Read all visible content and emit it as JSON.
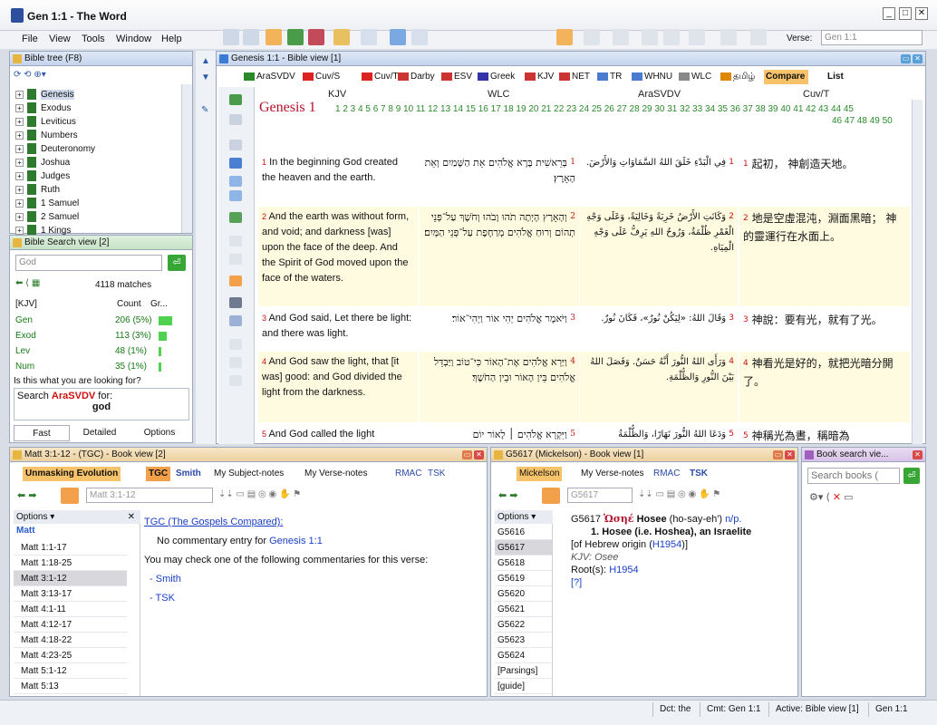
{
  "window": {
    "title": "Gen 1:1 - The Word"
  },
  "menu": [
    "File",
    "View",
    "Tools",
    "Window",
    "Help"
  ],
  "verse_label": "Verse:",
  "verse_value": "Gen 1:1",
  "bible_tree": {
    "title": "Bible tree (F8)",
    "books": [
      "Genesis",
      "Exodus",
      "Leviticus",
      "Numbers",
      "Deuteronomy",
      "Joshua",
      "Judges",
      "Ruth",
      "1 Samuel",
      "2 Samuel",
      "1 Kings"
    ]
  },
  "search_view": {
    "title": "Bible Search view [2]",
    "query": "God",
    "matches": "4118 matches",
    "col_version": "[KJV]",
    "col_count": "Count",
    "col_graph": "Gr...",
    "rows": [
      {
        "book": "Gen",
        "count": "206 (5%)",
        "pct": 5
      },
      {
        "book": "Exod",
        "count": "113 (3%)",
        "pct": 3
      },
      {
        "book": "Lev",
        "count": "48 (1%)",
        "pct": 1
      },
      {
        "book": "Num",
        "count": "35 (1%)",
        "pct": 1
      }
    ],
    "question": "Is this what you are looking for?",
    "search_prefix": "Search",
    "search_version": "AraSVDV",
    "search_suffix": "for:",
    "search_term": "god",
    "tabs": [
      "Fast",
      "Detailed",
      "Options"
    ]
  },
  "bible_view": {
    "title": "Genesis 1:1 - Bible view [1]",
    "tabs": [
      "AraSVDV",
      "Cuv/S",
      "Cuv/T",
      "Darby",
      "ESV",
      "Greek",
      "KJV",
      "NET",
      "TR",
      "WHNU",
      "WLC",
      "தமிழ்",
      "Compare",
      "List"
    ],
    "columns": [
      "KJV",
      "WLC",
      "AraSVDV",
      "Cuv/T"
    ],
    "heading": "Genesis 1",
    "chapters_line1": "1 2 3 4 5 6 7 8 9 10 11 12 13 14 15 16 17 18 19 20 21 22 23 24 25 26 27 28 29 30 31 32 33 34 35 36 37 38 39 40 41 42 43 44 45",
    "chapters_line2": "46 47 48 49 50",
    "verses": [
      {
        "n": "1",
        "kjv": "In the beginning God created the heaven and the earth.",
        "wlc": "בְּרֵאשִׁית בָּרָא אֱלֹהִים אֵת הַשָּׁמַיִם וְאֵת הָאָרֶץ׃",
        "ara": "فِي الْبَدْءِ خَلَقَ اللهُ السَّمَاوَاتِ وَالأَرْضَ.",
        "cuv": "起初， 神創造天地。"
      },
      {
        "n": "2",
        "kjv": "And the earth was without form, and void; and darkness [was] upon the face of the deep. And the Spirit of God moved upon the face of the waters.",
        "wlc": "וְהָאָרֶץ הָיְתָה תֹהוּ וָבֹהוּ וְחֹשֶׁךְ עַל־פְּנֵי תְהוֹם וְרוּחַ אֱלֹהִים מְרַחֶפֶת עַל־פְּנֵי הַמָּיִם׃",
        "ara": "وَكَانَتِ الأَرْضُ خَرِبَةً وَخَالِيَةً، وَعَلَى وَجْهِ الْغَمْرِ ظُلْمَةٌ، وَرُوحُ اللهِ يَرِفُّ عَلَى وَجْهِ الْمِيَاهِ.",
        "cuv": "地是空虛混沌，淵面黑暗； 神的靈運行在水面上。"
      },
      {
        "n": "3",
        "kjv": "And God said, Let there be light: and there was light.",
        "wlc": "וַיֹּאמֶר אֱלֹהִים יְהִי אוֹר וַיְהִי־אוֹר׃",
        "ara": "وَقَالَ اللهُ: «لِيَكُنْ نُورٌ»، فَكَانَ نُورٌ.",
        "cuv": "神說：要有光，就有了光。"
      },
      {
        "n": "4",
        "kjv": "And God saw the light, that [it was] good: and God divided the light from the darkness.",
        "wlc": "וַיַּרְא אֱלֹהִים אֶת־הָאוֹר כִּי־טוֹב וַיַּבְדֵּל אֱלֹהִים בֵּין הָאוֹר וּבֵין הַחֹשֶׁךְ׃",
        "ara": "وَرَأَى اللهُ النُّورَ أَنَّهُ حَسَنٌ. وَفَصَلَ اللهُ بَيْنَ النُّورِ وَالظُّلْمَةِ.",
        "cuv": "神看光是好的，就把光暗分開了。"
      },
      {
        "n": "5",
        "kjv": "And God called the light",
        "wlc": "וַיִּקְרָא אֱלֹהִים ׀ לָאוֹר יוֹם",
        "ara": "وَدَعَا اللهُ النُّورَ نَهَارًا، وَالظُّلْمَةُ",
        "cuv": "神稱光為晝，稱暗為"
      }
    ]
  },
  "commentary": {
    "title": "Matt 3:1-12 - (TGC) - Book view [2]",
    "tabs": [
      "Unmasking Evolution",
      "TGC",
      "Smith",
      "My Subject-notes",
      "My Verse-notes",
      "RMAC",
      "TSK"
    ],
    "ref_field": "Matt 3:1-12",
    "options": "Options",
    "book": "Matt",
    "refs": [
      "Matt 1:1-17",
      "Matt 1:18-25",
      "Matt 3:1-12",
      "Matt 3:13-17",
      "Matt 4:1-11",
      "Matt 4:12-17",
      "Matt 4:18-22",
      "Matt 4:23-25",
      "Matt 5:1-12",
      "Matt 5:13"
    ],
    "selected": "Matt 3:1-12",
    "link_title": "TGC (The Gospels Compared):",
    "no_entry": "No commentary entry for",
    "no_entry_ref": "Genesis 1:1",
    "may_check": "You may check one of the following commentaries for this verse:",
    "others": [
      "Smith",
      "TSK"
    ]
  },
  "lexicon": {
    "title": "G5617 (Mickelson) - Book view [1]",
    "tabs": [
      "Mickelson",
      "My Verse-notes",
      "RMAC",
      "TSK"
    ],
    "ref_field": "G5617",
    "options": "Options",
    "entries": [
      "G5616",
      "G5617",
      "G5618",
      "G5619",
      "G5620",
      "G5621",
      "G5622",
      "G5623",
      "G5624",
      "[Parsings]",
      "[guide]"
    ],
    "selected": "G5617",
    "code": "G5617",
    "greek": "Ὡσηέ",
    "translit": "Hosee",
    "pron": "(ho-say-eh')",
    "pos": "n/p.",
    "def1": "1. Hosee (i.e. Hoshea), an Israelite",
    "origin_prefix": "[of Hebrew origin (",
    "origin_link": "H1954",
    "origin_suffix": ")]",
    "kjv": "KJV: Osee",
    "roots_prefix": "Root(s):",
    "roots_link": "H1954",
    "q": "[?]"
  },
  "book_search": {
    "title": "Book search vie...",
    "placeholder": "Search books ("
  },
  "status": {
    "dct": "Dct: the",
    "cmt": "Cmt: Gen 1:1",
    "active": "Active: Bible view [1]",
    "ref": "Gen 1:1"
  }
}
